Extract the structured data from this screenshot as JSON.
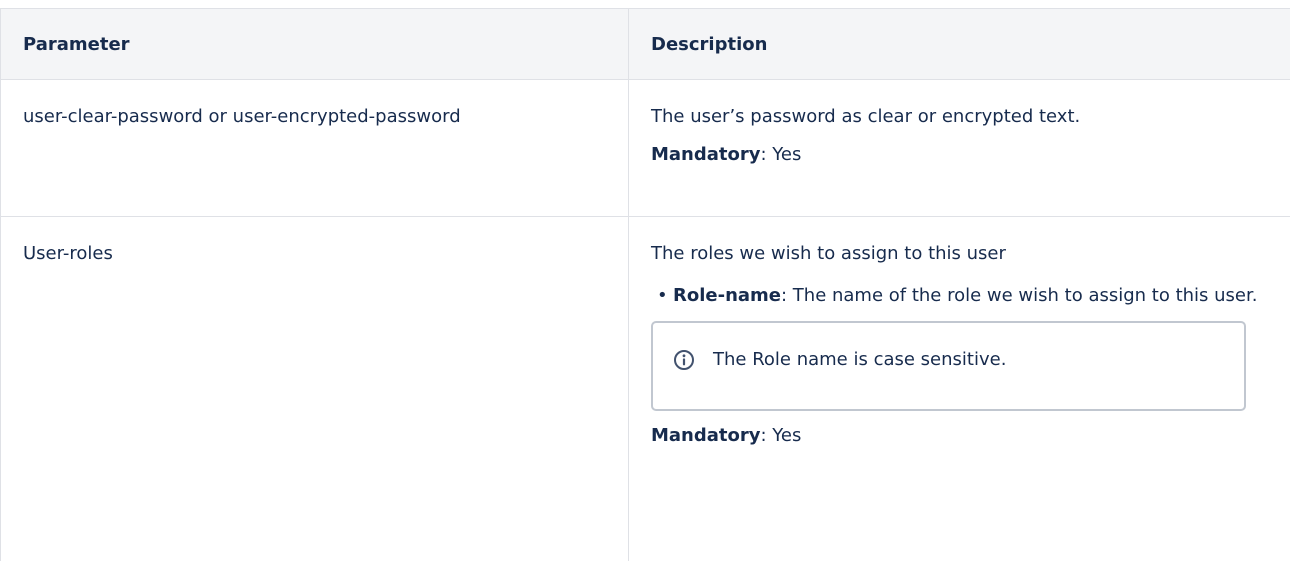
{
  "table": {
    "headers": [
      "Parameter",
      "Description"
    ],
    "rows": [
      {
        "parameter": "user-clear-password or user-encrypted-password",
        "description": "The user’s password as clear or encrypted text.",
        "mandatory_label": "Mandatory",
        "mandatory_value": ": Yes"
      },
      {
        "parameter": "User-roles",
        "description": "The roles we wish to assign to this user",
        "bullet_label": "Role-name",
        "bullet_text": ": The name of the role we wish to assign to this user.",
        "info_icon": "info-circle-icon",
        "info_text": "The Role name is case sensitive.",
        "mandatory_label": "Mandatory",
        "mandatory_value": ": Yes"
      }
    ]
  }
}
